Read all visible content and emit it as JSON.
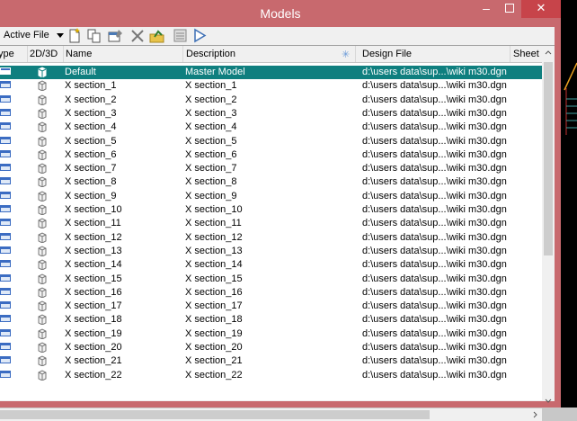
{
  "window": {
    "title": "Models"
  },
  "toolbar": {
    "active_file_label": "Active File"
  },
  "columns": [
    "ype",
    "2D/3D",
    "Name",
    "Description",
    "Design File",
    "Sheet"
  ],
  "colors": {
    "titlebar": "#c8696e",
    "selected_row": "#0f7f7f",
    "close_button": "#c7444a"
  },
  "rows": [
    {
      "name": "Default",
      "description": "Master Model",
      "file": "d:\\users data\\sup...\\wiki m30.dgn",
      "selected": true
    },
    {
      "name": "X section_1",
      "description": "X section_1",
      "file": "d:\\users data\\sup...\\wiki m30.dgn"
    },
    {
      "name": "X section_2",
      "description": "X section_2",
      "file": "d:\\users data\\sup...\\wiki m30.dgn"
    },
    {
      "name": "X section_3",
      "description": "X section_3",
      "file": "d:\\users data\\sup...\\wiki m30.dgn"
    },
    {
      "name": "X section_4",
      "description": "X section_4",
      "file": "d:\\users data\\sup...\\wiki m30.dgn"
    },
    {
      "name": "X section_5",
      "description": "X section_5",
      "file": "d:\\users data\\sup...\\wiki m30.dgn"
    },
    {
      "name": "X section_6",
      "description": "X section_6",
      "file": "d:\\users data\\sup...\\wiki m30.dgn"
    },
    {
      "name": "X section_7",
      "description": "X section_7",
      "file": "d:\\users data\\sup...\\wiki m30.dgn"
    },
    {
      "name": "X section_8",
      "description": "X section_8",
      "file": "d:\\users data\\sup...\\wiki m30.dgn"
    },
    {
      "name": "X section_9",
      "description": "X section_9",
      "file": "d:\\users data\\sup...\\wiki m30.dgn"
    },
    {
      "name": "X section_10",
      "description": "X section_10",
      "file": "d:\\users data\\sup...\\wiki m30.dgn"
    },
    {
      "name": "X section_11",
      "description": "X section_11",
      "file": "d:\\users data\\sup...\\wiki m30.dgn"
    },
    {
      "name": "X section_12",
      "description": "X section_12",
      "file": "d:\\users data\\sup...\\wiki m30.dgn"
    },
    {
      "name": "X section_13",
      "description": "X section_13",
      "file": "d:\\users data\\sup...\\wiki m30.dgn"
    },
    {
      "name": "X section_14",
      "description": "X section_14",
      "file": "d:\\users data\\sup...\\wiki m30.dgn"
    },
    {
      "name": "X section_15",
      "description": "X section_15",
      "file": "d:\\users data\\sup...\\wiki m30.dgn"
    },
    {
      "name": "X section_16",
      "description": "X section_16",
      "file": "d:\\users data\\sup...\\wiki m30.dgn"
    },
    {
      "name": "X section_17",
      "description": "X section_17",
      "file": "d:\\users data\\sup...\\wiki m30.dgn"
    },
    {
      "name": "X section_18",
      "description": "X section_18",
      "file": "d:\\users data\\sup...\\wiki m30.dgn"
    },
    {
      "name": "X section_19",
      "description": "X section_19",
      "file": "d:\\users data\\sup...\\wiki m30.dgn"
    },
    {
      "name": "X section_20",
      "description": "X section_20",
      "file": "d:\\users data\\sup...\\wiki m30.dgn"
    },
    {
      "name": "X section_21",
      "description": "X section_21",
      "file": "d:\\users data\\sup...\\wiki m30.dgn"
    },
    {
      "name": "X section_22",
      "description": "X section_22",
      "file": "d:\\users data\\sup...\\wiki m30.dgn"
    }
  ]
}
